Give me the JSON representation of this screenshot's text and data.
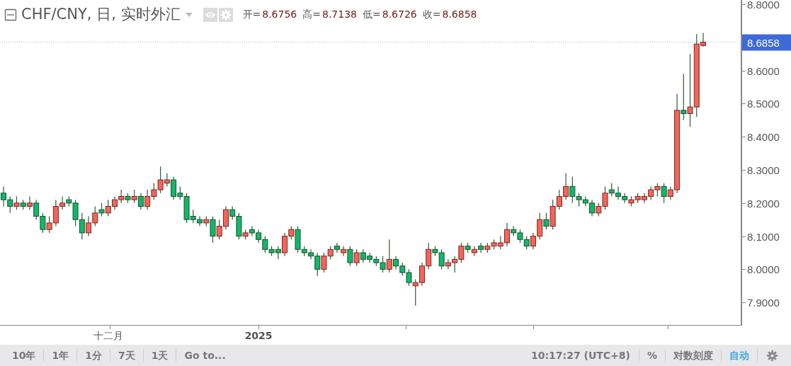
{
  "header": {
    "title": "CHF/CNY, 日, 实时外汇",
    "ohlc": [
      {
        "label": "开=",
        "value": "8.6756"
      },
      {
        "label": "高=",
        "value": "8.7138"
      },
      {
        "label": "低=",
        "value": "8.6726"
      },
      {
        "label": "收=",
        "value": "8.6858"
      }
    ]
  },
  "chart": {
    "chart_data": {
      "type": "candlestick",
      "ylim": [
        7.832,
        8.813
      ],
      "categories": [
        null,
        null,
        null,
        null,
        null,
        null,
        null,
        null,
        null,
        null,
        null,
        null,
        null,
        null,
        null,
        null,
        "十二月",
        null,
        null,
        null,
        null,
        null,
        null,
        null,
        null,
        null,
        null,
        null,
        null,
        null,
        null,
        null,
        null,
        null,
        null,
        null,
        null,
        null,
        null,
        "2025",
        null,
        null,
        null,
        null,
        null,
        null,
        null,
        null,
        null,
        null,
        null,
        null,
        null,
        null,
        null,
        null,
        null,
        null,
        null,
        null,
        null,
        null,
        null,
        null,
        null,
        null,
        null,
        null,
        null,
        null,
        null,
        null,
        null,
        null,
        null,
        null,
        null,
        null,
        null,
        null,
        null,
        null,
        null,
        null,
        null,
        null,
        null,
        null,
        null,
        null,
        null,
        null,
        null,
        null,
        null,
        null,
        null,
        null,
        null,
        null,
        null,
        null,
        null,
        null,
        null,
        null,
        null,
        null
      ],
      "ohlc": [
        [
          8.23,
          8.25,
          8.19,
          8.21
        ],
        [
          8.21,
          8.22,
          8.17,
          8.19
        ],
        [
          8.19,
          8.22,
          8.18,
          8.2
        ],
        [
          8.2,
          8.21,
          8.18,
          8.19
        ],
        [
          8.19,
          8.22,
          8.18,
          8.2
        ],
        [
          8.2,
          8.21,
          8.15,
          8.16
        ],
        [
          8.16,
          8.17,
          8.11,
          8.12
        ],
        [
          8.12,
          8.16,
          8.11,
          8.14
        ],
        [
          8.14,
          8.21,
          8.13,
          8.19
        ],
        [
          8.19,
          8.22,
          8.18,
          8.2
        ],
        [
          8.21,
          8.22,
          8.19,
          8.2
        ],
        [
          8.2,
          8.21,
          8.13,
          8.15
        ],
        [
          8.15,
          8.17,
          8.09,
          8.11
        ],
        [
          8.11,
          8.16,
          8.1,
          8.14
        ],
        [
          8.14,
          8.19,
          8.13,
          8.17
        ],
        [
          8.18,
          8.2,
          8.16,
          8.17
        ],
        [
          8.17,
          8.21,
          8.16,
          8.19
        ],
        [
          8.19,
          8.22,
          8.18,
          8.21
        ],
        [
          8.21,
          8.24,
          8.2,
          8.22
        ],
        [
          8.22,
          8.23,
          8.2,
          8.21
        ],
        [
          8.21,
          8.24,
          8.2,
          8.22
        ],
        [
          8.22,
          8.23,
          8.18,
          8.19
        ],
        [
          8.19,
          8.24,
          8.18,
          8.22
        ],
        [
          8.22,
          8.26,
          8.21,
          8.24
        ],
        [
          8.24,
          8.31,
          8.23,
          8.27
        ],
        [
          8.26,
          8.29,
          8.25,
          8.27
        ],
        [
          8.27,
          8.28,
          8.21,
          8.22
        ],
        [
          8.23,
          8.25,
          8.21,
          8.22
        ],
        [
          8.22,
          8.23,
          8.14,
          8.15
        ],
        [
          8.16,
          8.18,
          8.14,
          8.15
        ],
        [
          8.15,
          8.16,
          8.13,
          8.14
        ],
        [
          8.14,
          8.16,
          8.13,
          8.15
        ],
        [
          8.15,
          8.16,
          8.08,
          8.1
        ],
        [
          8.1,
          8.15,
          8.09,
          8.13
        ],
        [
          8.13,
          8.19,
          8.12,
          8.18
        ],
        [
          8.18,
          8.19,
          8.15,
          8.16
        ],
        [
          8.16,
          8.17,
          8.09,
          8.1
        ],
        [
          8.1,
          8.12,
          8.09,
          8.11
        ],
        [
          8.12,
          8.13,
          8.1,
          8.11
        ],
        [
          8.11,
          8.12,
          8.08,
          8.09
        ],
        [
          8.09,
          8.1,
          8.05,
          8.06
        ],
        [
          8.06,
          8.07,
          8.04,
          8.05
        ],
        [
          8.06,
          8.07,
          8.03,
          8.05
        ],
        [
          8.05,
          8.11,
          8.04,
          8.1
        ],
        [
          8.1,
          8.13,
          8.09,
          8.12
        ],
        [
          8.12,
          8.13,
          8.05,
          8.06
        ],
        [
          8.06,
          8.07,
          8.04,
          8.05
        ],
        [
          8.05,
          8.06,
          8.03,
          8.04
        ],
        [
          8.04,
          8.05,
          7.98,
          8.0
        ],
        [
          8.0,
          8.05,
          7.99,
          8.04
        ],
        [
          8.04,
          8.07,
          8.03,
          8.06
        ],
        [
          8.07,
          8.08,
          8.05,
          8.06
        ],
        [
          8.05,
          8.07,
          8.04,
          8.06
        ],
        [
          8.06,
          8.07,
          8.01,
          8.02
        ],
        [
          8.02,
          8.06,
          8.01,
          8.05
        ],
        [
          8.05,
          8.06,
          8.02,
          8.03
        ],
        [
          8.04,
          8.05,
          8.02,
          8.03
        ],
        [
          8.03,
          8.04,
          8.01,
          8.02
        ],
        [
          8.02,
          8.04,
          7.99,
          8.0
        ],
        [
          8.0,
          8.09,
          7.99,
          8.03
        ],
        [
          8.03,
          8.04,
          8.0,
          8.01
        ],
        [
          8.01,
          8.02,
          7.98,
          7.99
        ],
        [
          7.99,
          8.0,
          7.95,
          7.96
        ],
        [
          7.95,
          7.97,
          7.89,
          7.96
        ],
        [
          7.96,
          8.02,
          7.95,
          8.01
        ],
        [
          8.01,
          8.08,
          8.0,
          8.06
        ],
        [
          8.06,
          8.07,
          8.04,
          8.05
        ],
        [
          8.05,
          8.06,
          8.0,
          8.01
        ],
        [
          8.01,
          8.03,
          8.0,
          8.02
        ],
        [
          8.02,
          8.04,
          7.99,
          8.03
        ],
        [
          8.03,
          8.08,
          8.02,
          8.07
        ],
        [
          8.07,
          8.08,
          8.05,
          8.06
        ],
        [
          8.05,
          8.07,
          8.04,
          8.06
        ],
        [
          8.07,
          8.08,
          8.05,
          8.06
        ],
        [
          8.06,
          8.08,
          8.05,
          8.07
        ],
        [
          8.07,
          8.09,
          8.06,
          8.08
        ],
        [
          8.07,
          8.1,
          8.06,
          8.08
        ],
        [
          8.08,
          8.14,
          8.07,
          8.12
        ],
        [
          8.12,
          8.13,
          8.1,
          8.11
        ],
        [
          8.11,
          8.12,
          8.08,
          8.09
        ],
        [
          8.09,
          8.1,
          8.06,
          8.07
        ],
        [
          8.07,
          8.11,
          8.06,
          8.1
        ],
        [
          8.1,
          8.17,
          8.09,
          8.15
        ],
        [
          8.15,
          8.17,
          8.12,
          8.13
        ],
        [
          8.13,
          8.21,
          8.12,
          8.19
        ],
        [
          8.19,
          8.24,
          8.18,
          8.22
        ],
        [
          8.22,
          8.29,
          8.21,
          8.25
        ],
        [
          8.25,
          8.28,
          8.2,
          8.22
        ],
        [
          8.22,
          8.23,
          8.19,
          8.21
        ],
        [
          8.21,
          8.22,
          8.19,
          8.2
        ],
        [
          8.2,
          8.21,
          8.16,
          8.17
        ],
        [
          8.17,
          8.2,
          8.16,
          8.19
        ],
        [
          8.19,
          8.25,
          8.18,
          8.23
        ],
        [
          8.24,
          8.26,
          8.22,
          8.23
        ],
        [
          8.23,
          8.25,
          8.21,
          8.22
        ],
        [
          8.22,
          8.23,
          8.2,
          8.21
        ],
        [
          8.2,
          8.22,
          8.19,
          8.21
        ],
        [
          8.21,
          8.23,
          8.2,
          8.22
        ],
        [
          8.21,
          8.23,
          8.2,
          8.22
        ],
        [
          8.22,
          8.25,
          8.21,
          8.24
        ],
        [
          8.24,
          8.26,
          8.22,
          8.25
        ],
        [
          8.25,
          8.26,
          8.2,
          8.22
        ],
        [
          8.22,
          8.25,
          8.21,
          8.24
        ],
        [
          8.24,
          8.53,
          8.23,
          8.48
        ],
        [
          8.48,
          8.59,
          8.45,
          8.47
        ],
        [
          8.47,
          8.65,
          8.43,
          8.49
        ],
        [
          8.49,
          8.71,
          8.46,
          8.68
        ],
        [
          8.6756,
          8.7138,
          8.6726,
          8.6858
        ]
      ],
      "yticks": [
        {
          "value": 8.8,
          "label": "8.8000"
        },
        {
          "value": 8.6,
          "label": "8.6000"
        },
        {
          "value": 8.5,
          "label": "8.5000"
        },
        {
          "value": 8.4,
          "label": "8.4000"
        },
        {
          "value": 8.3,
          "label": "8.3000"
        },
        {
          "value": 8.2,
          "label": "8.2000"
        },
        {
          "value": 8.1,
          "label": "8.1000"
        },
        {
          "value": 8.0,
          "label": "8.0000"
        },
        {
          "value": 7.9,
          "label": "7.9000"
        }
      ],
      "ref_lines": [
        {
          "axis": "y",
          "value": 8.6858
        }
      ]
    },
    "x_label_styles": [
      {
        "bold": false
      },
      {
        "bold": true
      }
    ],
    "last_price": "8.6858"
  },
  "toolbar": {
    "ranges": [
      {
        "label": "10年"
      },
      {
        "label": "1年"
      },
      {
        "label": "1分"
      },
      {
        "label": "7天"
      },
      {
        "label": "1天"
      },
      {
        "label": "Go to..."
      }
    ],
    "time": "10:17:27 (UTC+8)",
    "options": [
      {
        "label": "%",
        "selected": false
      },
      {
        "label": "对数刻度",
        "selected": false
      },
      {
        "label": "自动",
        "selected": true
      }
    ]
  }
}
